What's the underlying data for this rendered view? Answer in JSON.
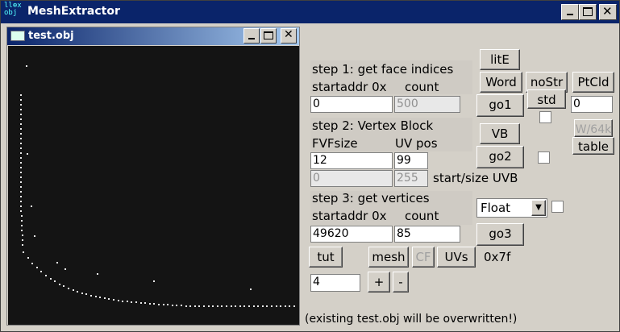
{
  "app": {
    "title": "MeshExtractor",
    "icon_text": "ll⊕x obj"
  },
  "inner_window": {
    "title": "test.obj"
  },
  "window_buttons": {
    "min": "_",
    "max": "□",
    "close": "✕"
  },
  "step1": {
    "heading": "step 1: get face indices",
    "sub_left": "startaddr 0x",
    "sub_right": "count",
    "startaddr": "0",
    "count": "500"
  },
  "step2": {
    "heading": "step 2: Vertex Block",
    "sub_left": "FVFsize",
    "sub_right": "UV pos",
    "fvfsize": "12",
    "uvpos": "99",
    "start": "0",
    "size": "255",
    "startsize_label": "start/size UVB"
  },
  "step3": {
    "heading": "step 3: get vertices",
    "sub_left": "startaddr 0x",
    "sub_right": "count",
    "startaddr": "49620",
    "count": "85"
  },
  "buttons": {
    "litE": "litE",
    "word": "Word",
    "go1": "go1",
    "nostr": "noStr",
    "std": "std",
    "ptcld": "PtCld",
    "w64k": "W/64k",
    "table": "table",
    "vb": "VB",
    "go2": "go2",
    "go3": "go3",
    "tut": "tut",
    "mesh": "mesh",
    "cf": "CF",
    "uvs": "UVs",
    "plus": "+",
    "minus": "-"
  },
  "ptcld_value": "0",
  "float_select": {
    "selected": "Float"
  },
  "hex_label": "0x7f",
  "step_value": "4",
  "footer": "(existing test.obj will be overwritten!)",
  "chart_data": {
    "type": "scatter",
    "title": "",
    "points_desc": "point cloud preview of mesh vertices"
  }
}
